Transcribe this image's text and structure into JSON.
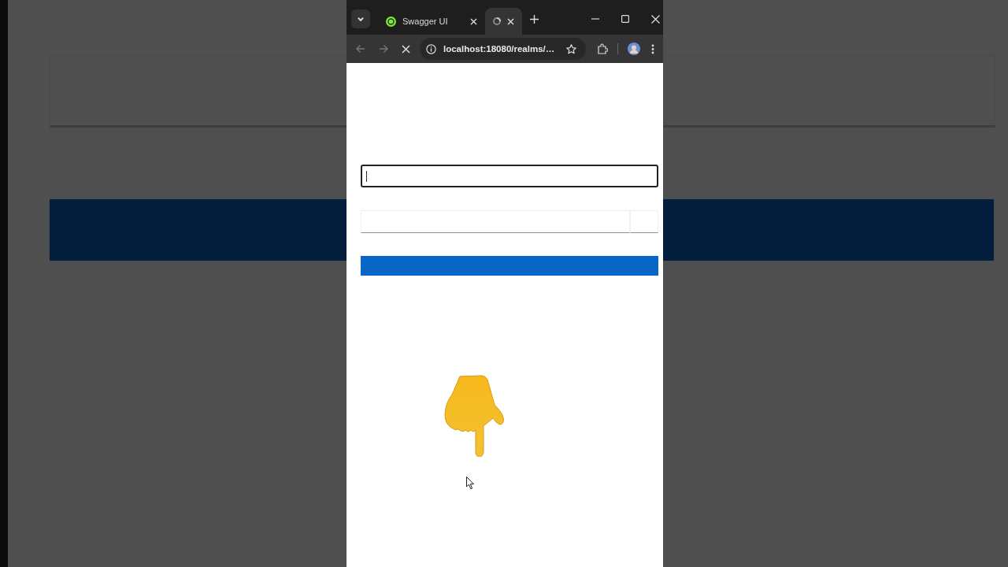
{
  "browser": {
    "tabs": [
      {
        "label": "Swagger UI",
        "kind": "site",
        "selected": false
      },
      {
        "kind": "loading",
        "selected": true
      }
    ],
    "loading": true,
    "address": "localhost:18080/realms/…"
  },
  "login_form": {
    "fields": [
      {
        "kind": "text",
        "focused": true
      },
      {
        "kind": "password",
        "focused": false
      }
    ]
  }
}
